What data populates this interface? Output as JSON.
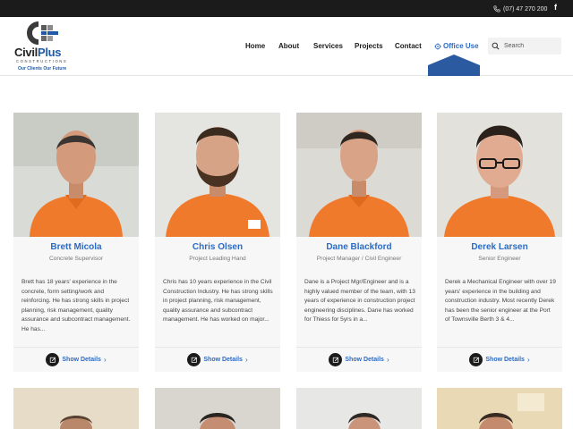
{
  "topbar": {
    "phone": "(07) 47 270 200",
    "facebook_glyph": "f",
    "icons": [
      "phone-icon",
      "facebook-icon"
    ]
  },
  "logo": {
    "brand_main": "Civil",
    "brand_accent": "Plus",
    "subtitle": "CONSTRUCTIONS",
    "tagline": "Our Clients Our Future"
  },
  "nav": {
    "home": "Home",
    "about": "About",
    "services": "Services",
    "projects": "Projects",
    "contact": "Contact",
    "office_use": "Office Use"
  },
  "search": {
    "placeholder": "Search"
  },
  "team": [
    {
      "name": "Brett Micola",
      "role": "Concrete Supervisor",
      "bio": "Brett has 18 years' experience in the concrete, form setting/work and reinforcing. He has strong skills in project planning, risk management, quality assurance and subcontract management. He has...",
      "link": "Show Details"
    },
    {
      "name": "Chris Olsen",
      "role": "Project Leading Hand",
      "bio": "Chris has 10 years experience in the Civil Construction Industry. He has strong skills in project planning, risk management, quality assurance and subcontract management. He has worked on major...",
      "link": "Show Details"
    },
    {
      "name": "Dane Blackford",
      "role": "Project Manager / Civil Engineer",
      "bio": "Dane is a Project Mgr/Engineer and is a highly valued member of the team, with 13 years of experience in construction project engineering disciplines. Dane has worked for Thiess for 5yrs in a...",
      "link": "Show Details"
    },
    {
      "name": "Derek Larsen",
      "role": "Senior Engineer",
      "bio": "Derek a Mechanical Engineer with over 19 years' experience in the building and construction industry. Most recently Derek has been the senior engineer at the Port of Townsville Berth 3 & 4...",
      "link": "Show Details"
    }
  ],
  "colors": {
    "accent": "#2c6bc4",
    "topbar": "#1b1b1b",
    "office_tab": "#2c5aa0",
    "shirt_orange": "#f07a2c"
  }
}
